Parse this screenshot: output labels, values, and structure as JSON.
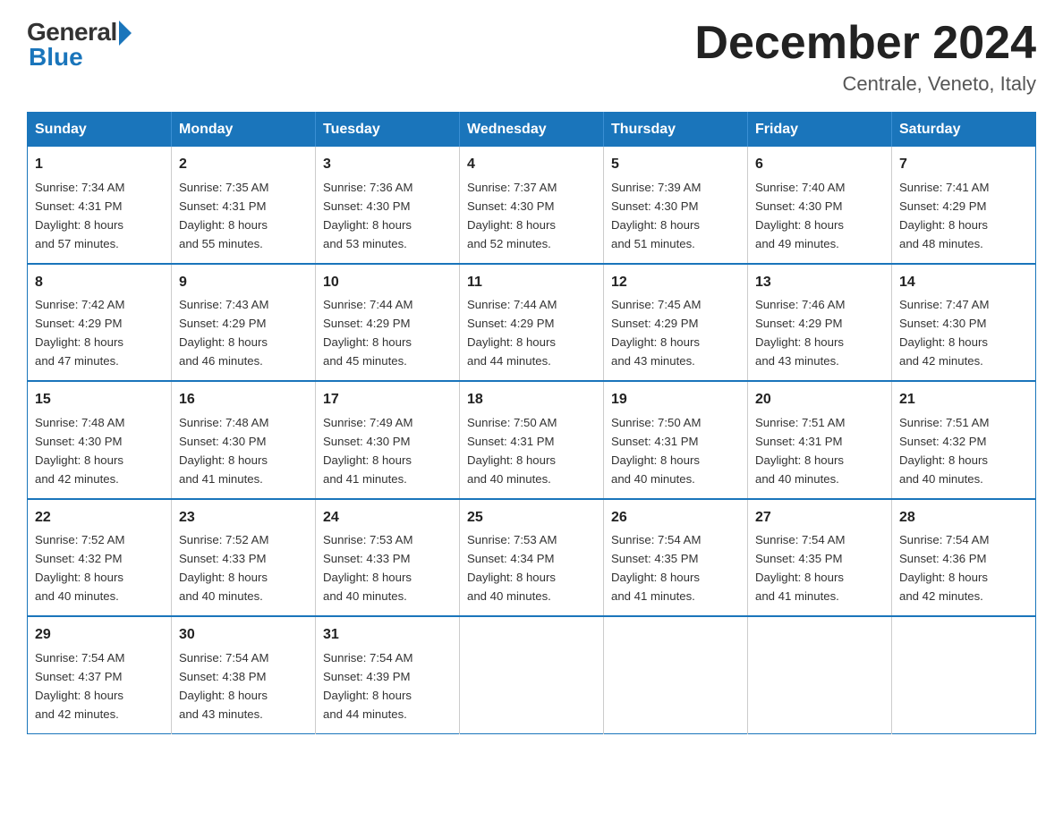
{
  "logo": {
    "general": "General",
    "blue": "Blue"
  },
  "title": "December 2024",
  "subtitle": "Centrale, Veneto, Italy",
  "weekdays": [
    "Sunday",
    "Monday",
    "Tuesday",
    "Wednesday",
    "Thursday",
    "Friday",
    "Saturday"
  ],
  "weeks": [
    [
      {
        "day": "1",
        "sunrise": "7:34 AM",
        "sunset": "4:31 PM",
        "daylight": "8 hours and 57 minutes."
      },
      {
        "day": "2",
        "sunrise": "7:35 AM",
        "sunset": "4:31 PM",
        "daylight": "8 hours and 55 minutes."
      },
      {
        "day": "3",
        "sunrise": "7:36 AM",
        "sunset": "4:30 PM",
        "daylight": "8 hours and 53 minutes."
      },
      {
        "day": "4",
        "sunrise": "7:37 AM",
        "sunset": "4:30 PM",
        "daylight": "8 hours and 52 minutes."
      },
      {
        "day": "5",
        "sunrise": "7:39 AM",
        "sunset": "4:30 PM",
        "daylight": "8 hours and 51 minutes."
      },
      {
        "day": "6",
        "sunrise": "7:40 AM",
        "sunset": "4:30 PM",
        "daylight": "8 hours and 49 minutes."
      },
      {
        "day": "7",
        "sunrise": "7:41 AM",
        "sunset": "4:29 PM",
        "daylight": "8 hours and 48 minutes."
      }
    ],
    [
      {
        "day": "8",
        "sunrise": "7:42 AM",
        "sunset": "4:29 PM",
        "daylight": "8 hours and 47 minutes."
      },
      {
        "day": "9",
        "sunrise": "7:43 AM",
        "sunset": "4:29 PM",
        "daylight": "8 hours and 46 minutes."
      },
      {
        "day": "10",
        "sunrise": "7:44 AM",
        "sunset": "4:29 PM",
        "daylight": "8 hours and 45 minutes."
      },
      {
        "day": "11",
        "sunrise": "7:44 AM",
        "sunset": "4:29 PM",
        "daylight": "8 hours and 44 minutes."
      },
      {
        "day": "12",
        "sunrise": "7:45 AM",
        "sunset": "4:29 PM",
        "daylight": "8 hours and 43 minutes."
      },
      {
        "day": "13",
        "sunrise": "7:46 AM",
        "sunset": "4:29 PM",
        "daylight": "8 hours and 43 minutes."
      },
      {
        "day": "14",
        "sunrise": "7:47 AM",
        "sunset": "4:30 PM",
        "daylight": "8 hours and 42 minutes."
      }
    ],
    [
      {
        "day": "15",
        "sunrise": "7:48 AM",
        "sunset": "4:30 PM",
        "daylight": "8 hours and 42 minutes."
      },
      {
        "day": "16",
        "sunrise": "7:48 AM",
        "sunset": "4:30 PM",
        "daylight": "8 hours and 41 minutes."
      },
      {
        "day": "17",
        "sunrise": "7:49 AM",
        "sunset": "4:30 PM",
        "daylight": "8 hours and 41 minutes."
      },
      {
        "day": "18",
        "sunrise": "7:50 AM",
        "sunset": "4:31 PM",
        "daylight": "8 hours and 40 minutes."
      },
      {
        "day": "19",
        "sunrise": "7:50 AM",
        "sunset": "4:31 PM",
        "daylight": "8 hours and 40 minutes."
      },
      {
        "day": "20",
        "sunrise": "7:51 AM",
        "sunset": "4:31 PM",
        "daylight": "8 hours and 40 minutes."
      },
      {
        "day": "21",
        "sunrise": "7:51 AM",
        "sunset": "4:32 PM",
        "daylight": "8 hours and 40 minutes."
      }
    ],
    [
      {
        "day": "22",
        "sunrise": "7:52 AM",
        "sunset": "4:32 PM",
        "daylight": "8 hours and 40 minutes."
      },
      {
        "day": "23",
        "sunrise": "7:52 AM",
        "sunset": "4:33 PM",
        "daylight": "8 hours and 40 minutes."
      },
      {
        "day": "24",
        "sunrise": "7:53 AM",
        "sunset": "4:33 PM",
        "daylight": "8 hours and 40 minutes."
      },
      {
        "day": "25",
        "sunrise": "7:53 AM",
        "sunset": "4:34 PM",
        "daylight": "8 hours and 40 minutes."
      },
      {
        "day": "26",
        "sunrise": "7:54 AM",
        "sunset": "4:35 PM",
        "daylight": "8 hours and 41 minutes."
      },
      {
        "day": "27",
        "sunrise": "7:54 AM",
        "sunset": "4:35 PM",
        "daylight": "8 hours and 41 minutes."
      },
      {
        "day": "28",
        "sunrise": "7:54 AM",
        "sunset": "4:36 PM",
        "daylight": "8 hours and 42 minutes."
      }
    ],
    [
      {
        "day": "29",
        "sunrise": "7:54 AM",
        "sunset": "4:37 PM",
        "daylight": "8 hours and 42 minutes."
      },
      {
        "day": "30",
        "sunrise": "7:54 AM",
        "sunset": "4:38 PM",
        "daylight": "8 hours and 43 minutes."
      },
      {
        "day": "31",
        "sunrise": "7:54 AM",
        "sunset": "4:39 PM",
        "daylight": "8 hours and 44 minutes."
      },
      null,
      null,
      null,
      null
    ]
  ],
  "labels": {
    "sunrise": "Sunrise:",
    "sunset": "Sunset:",
    "daylight": "Daylight:"
  },
  "colors": {
    "header_bg": "#1a75bb",
    "header_text": "#ffffff",
    "border": "#1a75bb"
  }
}
